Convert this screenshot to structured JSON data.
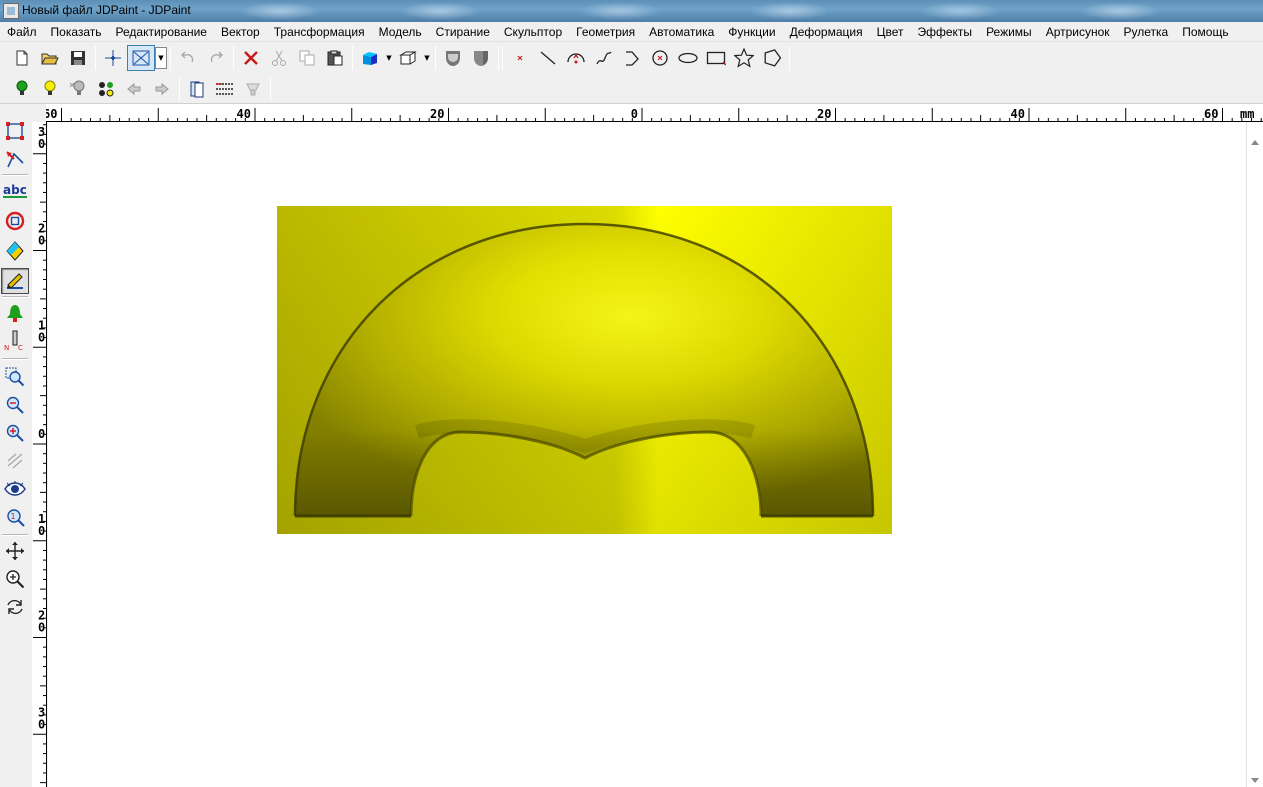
{
  "window": {
    "title": "Новый файл JDPaint - JDPaint"
  },
  "menu": {
    "items": [
      "Файл",
      "Показать",
      "Редактирование",
      "Вектор",
      "Трансформация",
      "Модель",
      "Стирание",
      "Скульптор",
      "Геометрия",
      "Автоматика",
      "Функции",
      "Деформация",
      "Цвет",
      "Эффекты",
      "Режимы",
      "Артрисунок",
      "Рулетка",
      "Помощь"
    ]
  },
  "toolbar1": {
    "icons": [
      "new-file-icon",
      "open-folder-icon",
      "save-icon",
      "crosshair-icon",
      "fit-window-icon",
      "undo-icon",
      "redo-icon",
      "delete-icon",
      "cut-icon",
      "copy-icon",
      "paste-icon",
      "color-cube-icon",
      "wire-box-icon",
      "shield-shade-icon",
      "shield-solid-icon",
      "point-icon",
      "line-icon",
      "arc-icon",
      "curve-icon",
      "polyline-icon",
      "circle-icon",
      "ellipse-icon",
      "rectangle-icon",
      "star-icon",
      "polygon-icon"
    ]
  },
  "toolbar2": {
    "icons": [
      "green-bulb-icon",
      "yellow-bulb-icon",
      "grey-bulb-icon",
      "light-dots-icon",
      "arrow-left-icon",
      "arrow-right-icon",
      "book-icon",
      "grid-lines-icon",
      "lamp-icon"
    ]
  },
  "ruler": {
    "unit": "mm",
    "h_labels": [
      "60",
      "40",
      "20",
      "0",
      "20",
      "40",
      "60"
    ],
    "v_labels": [
      [
        "3",
        "0"
      ],
      [
        "2",
        "0"
      ],
      [
        "1",
        "0"
      ],
      [
        "0"
      ],
      [
        "1",
        "0"
      ],
      [
        "2",
        "0"
      ],
      [
        "3",
        "0"
      ]
    ]
  },
  "palette": {
    "tools": [
      "node-edit-icon",
      "vector-arrow-icon",
      "text-abc-icon",
      "stop-circle-icon",
      "diamond-tool-icon",
      "paint-brush-icon",
      "green-bell-icon",
      "ruler-nc-icon",
      "zoom-area-icon",
      "zoom-out-icon",
      "zoom-in-icon",
      "redraw-icon",
      "eye-icon",
      "zoom-page-icon",
      "pan-icon",
      "zoom-icon",
      "rotate-icon"
    ]
  },
  "colors": {
    "relief_bright": "#fafa00",
    "relief_mid": "#c8c400",
    "relief_dark": "#8e8a00",
    "background": "#b4b200"
  }
}
